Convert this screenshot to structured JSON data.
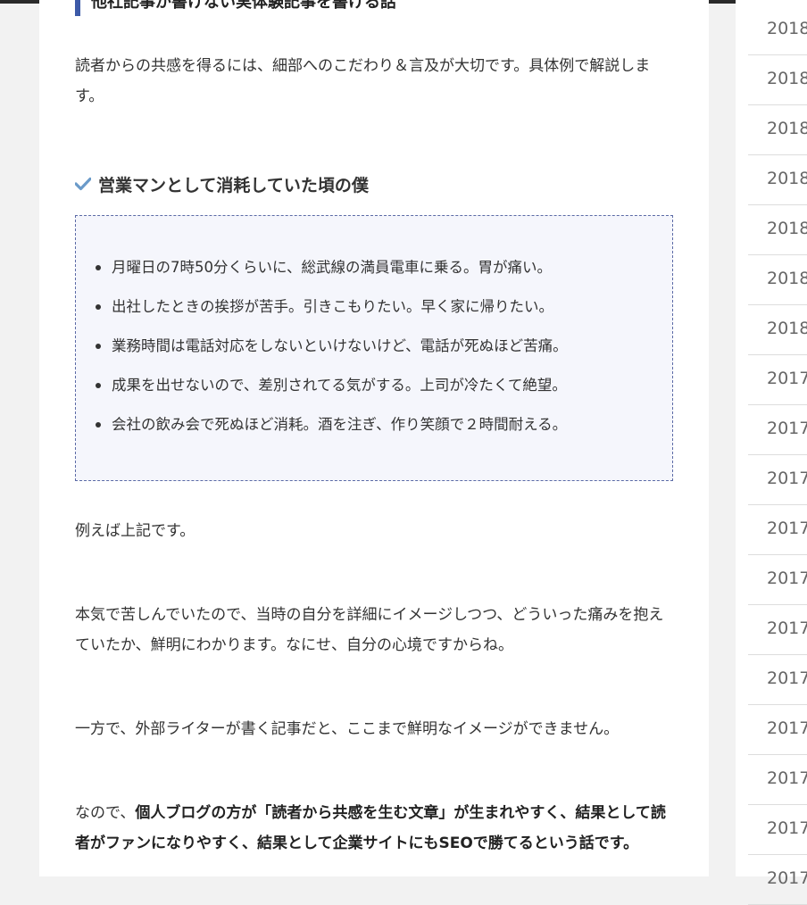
{
  "article": {
    "clipped_heading": "他社記事が書けない実体験記事を書ける話",
    "intro": "読者からの共感を得るには、細部へのこだわり＆言及が大切です。具体例で解説します。",
    "check_heading": "営業マンとして消耗していた頃の僕",
    "list_items": [
      "月曜日の7時50分くらいに、総武線の満員電車に乗る。胃が痛い。",
      "出社したときの挨拶が苦手。引きこもりたい。早く家に帰りたい。",
      "業務時間は電話対応をしないといけないけど、電話が死ぬほど苦痛。",
      "成果を出せないので、差別されてる気がする。上司が冷たくて絶望。",
      "会社の飲み会で死ぬほど消耗。酒を注ぎ、作り笑顔で２時間耐える。"
    ],
    "p1": "例えば上記です。",
    "p2": "本気で苦しんでいたので、当時の自分を詳細にイメージしつつ、どういった痛みを抱えていたか、鮮明にわかります。なにせ、自分の心境ですからね。",
    "p3": "一方で、外部ライターが書く記事だと、ここまで鮮明なイメージができません。",
    "p4_prefix": "なので、",
    "p4_bold": "個人ブログの方が「読者から共感を生む文章」が生まれやすく、結果として読者がファンになりやすく、結果として企業サイトにもSEOで勝てるという話です。"
  },
  "sidebar": {
    "archive_years": [
      "2018",
      "2018",
      "2018",
      "2018",
      "2018",
      "2018",
      "2018",
      "2017",
      "2017",
      "2017",
      "2017",
      "2017",
      "2017",
      "2017",
      "2017",
      "2017",
      "2017",
      "2017"
    ]
  },
  "colors": {
    "accent": "#3d5aa8",
    "check": "#6a9ac9",
    "box_bg": "#f5f6fc"
  }
}
